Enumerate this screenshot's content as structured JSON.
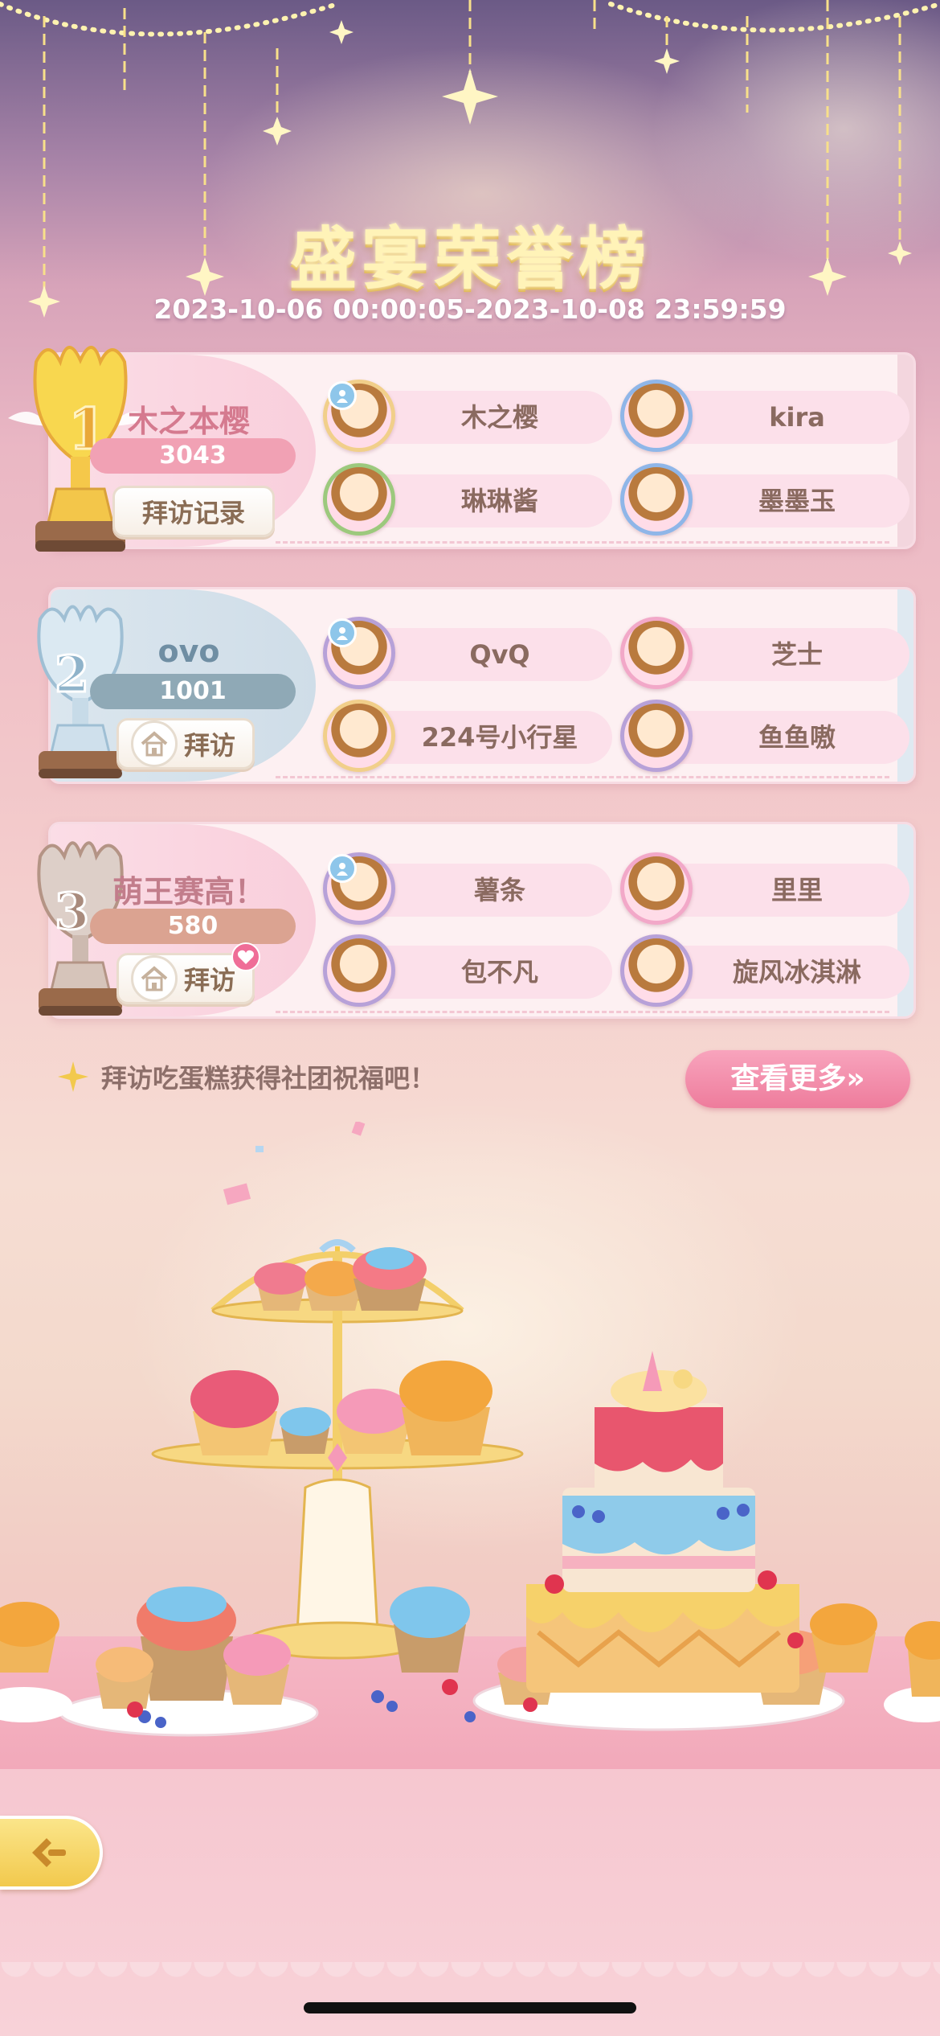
{
  "header": {
    "title": "盛宴荣誉榜",
    "date_range": "2023-10-06 00:00:05-2023-10-08 23:59:59"
  },
  "rankings": [
    {
      "rank": "1",
      "leader_name": "木之本樱",
      "score": "3043",
      "button_label": "拜访记录",
      "members": [
        "木之樱",
        "kira",
        "琳琳酱",
        "墨墨玉"
      ]
    },
    {
      "rank": "2",
      "leader_name": "ovo",
      "score": "1001",
      "button_label": "拜访",
      "members": [
        "QvQ",
        "芝士",
        "224号小行星",
        "鱼鱼嗷"
      ]
    },
    {
      "rank": "3",
      "leader_name": "萌王赛高！",
      "score": "580",
      "button_label": "拜访",
      "members": [
        "薯条",
        "里里",
        "包不凡",
        "旋风冰淇淋"
      ]
    }
  ],
  "footer": {
    "hint": "拜访吃蛋糕获得社团祝福吧！",
    "more_button": "查看更多»"
  },
  "colors": {
    "gold": "#f2c94d",
    "silver": "#a9c4d6",
    "bronze": "#c9a99a",
    "accent_pink": "#ee7c9c"
  },
  "icons": [
    "sparkle-icon",
    "home-icon",
    "back-icon",
    "heart-badge-icon",
    "person-icon"
  ]
}
